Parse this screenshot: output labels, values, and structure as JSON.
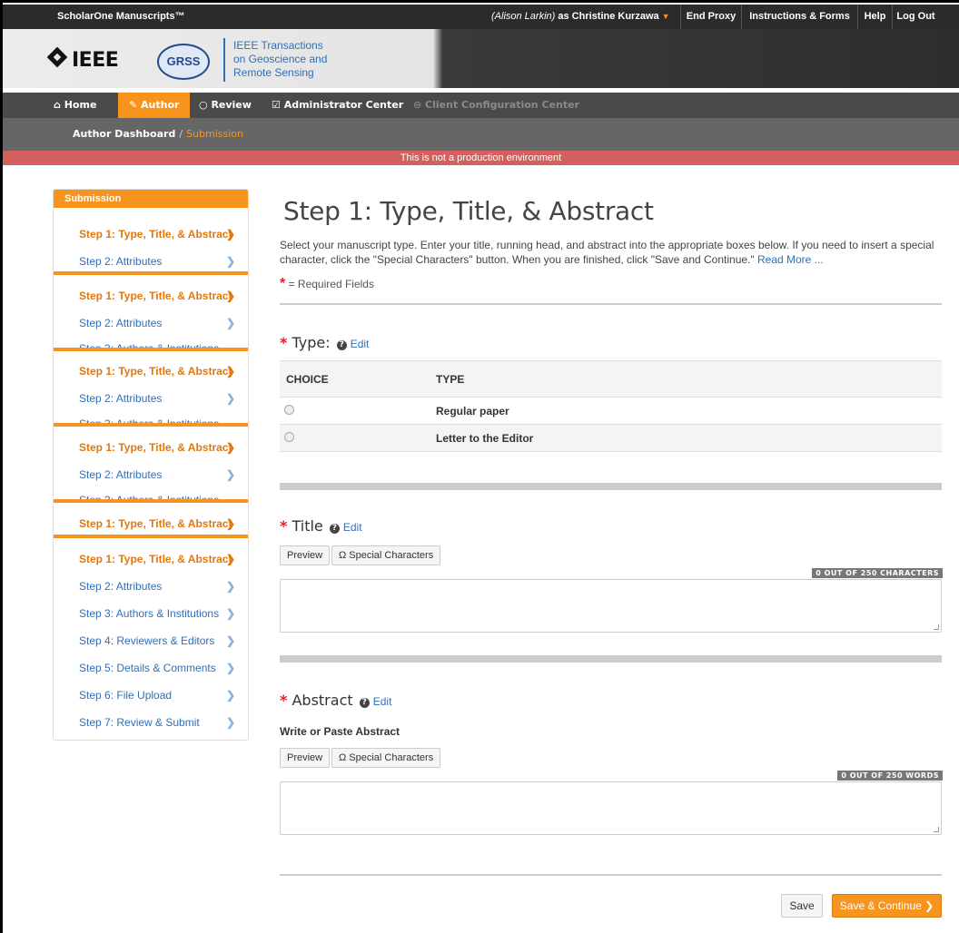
{
  "topbar": {
    "brand": "ScholarOne Manuscripts™",
    "proxy_name": "(Alison Larkin)",
    "proxy_as": " as Christine Kurzawa",
    "links": [
      "End Proxy",
      "Instructions & Forms",
      "Help",
      "Log Out"
    ]
  },
  "header": {
    "logo": "IEEE",
    "society": "GRSS",
    "journal_line1": "IEEE Transactions",
    "journal_line2": "on Geoscience and",
    "journal_line3": "Remote Sensing"
  },
  "nav": {
    "home": "Home",
    "author": "Author",
    "review": "Review",
    "admin": "Administrator Center",
    "client": "Client Configuration Center"
  },
  "breadcrumb": {
    "dashboard": "Author Dashboard",
    "separator": "/",
    "current": "Submission"
  },
  "warning": "This is not a production environment",
  "sidebar": {
    "header": "Submission",
    "step1": "Step 1: Type, Title, & Abstract",
    "step2": "Step 2: Attributes",
    "step3": "Step 3: Authors & Institutions",
    "step4": "Step 4: Reviewers & Editors",
    "step5": "Step 5: Details & Comments",
    "step6": "Step 6: File Upload",
    "step7": "Step 7: Review & Submit"
  },
  "main": {
    "title": "Step 1: Type, Title, & Abstract",
    "intro": "Select your manuscript type. Enter your title, running head, and abstract into the appropriate boxes below. If you need to insert a special character, click the \"Special Characters\" button. When you are finished, click \"Save and Continue.\"",
    "read_more": "Read More ...",
    "required_note": "= Required Fields",
    "type_label": "Type:",
    "edit": "Edit",
    "col_choice": "CHOICE",
    "col_type": "TYPE",
    "types": [
      "Regular paper",
      "Letter to the Editor"
    ],
    "title_label": "Title",
    "abstract_label": "Abstract",
    "preview": "Preview",
    "special_chars": "Ω Special Characters",
    "title_counter": "0 OUT OF 250 CHARACTERS",
    "write_abstract": "Write or Paste Abstract",
    "abstract_counter": "0 OUT OF 250 WORDS",
    "save": "Save",
    "save_continue": "Save & Continue"
  }
}
